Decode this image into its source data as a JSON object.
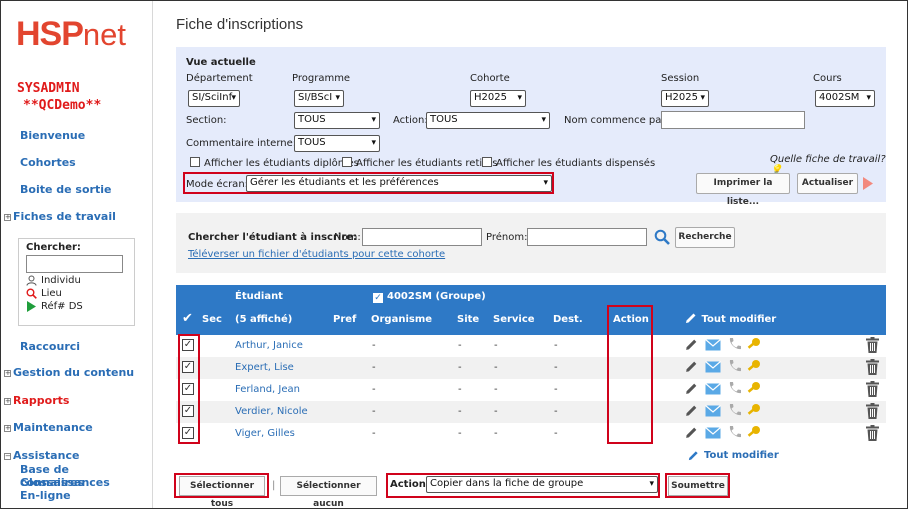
{
  "sidebar": {
    "logo_hsp": "HSP",
    "logo_net": "net",
    "user_name": "SYSADMIN",
    "user_org": "**QCDemo**",
    "items": {
      "bienvenue": "Bienvenue",
      "cohortes": "Cohortes",
      "boite": "Boite de sortie",
      "fiches": "Fiches de travail",
      "raccourci": "Raccourci",
      "gestion": "Gestion du contenu",
      "rapports": "Rapports",
      "maintenance": "Maintenance",
      "assistance": "Assistance",
      "base": "Base de connaissances",
      "glossaires": "Glossaires",
      "enligne": "En-ligne"
    },
    "search": {
      "label": "Chercher:",
      "opt_individu": "Individu",
      "opt_lieu": "Lieu",
      "opt_ref": "Réf# DS"
    }
  },
  "page": {
    "title": "Fiche d'inscriptions"
  },
  "view": {
    "heading": "Vue actuelle",
    "departement_label": "Département",
    "departement_value": "SI/SciInf",
    "programme_label": "Programme",
    "programme_value": "SI/BScI",
    "cohorte_label": "Cohorte",
    "cohorte_value": "H2025",
    "session_label": "Session",
    "session_value": "H2025",
    "cours_label": "Cours",
    "cours_value": "4002SM",
    "section_label": "Section:",
    "section_value": "TOUS",
    "action_label": "Action:",
    "action_value": "TOUS",
    "nom_label": "Nom commence par:",
    "commentaire_label": "Commentaire interne:",
    "commentaire_value": "TOUS",
    "chk_diplomes": "Afficher les étudiants diplômés",
    "chk_retires": "Afficher les étudiants retirés",
    "chk_dispenses": "Afficher les étudiants dispensés",
    "quelle_fiche": "Quelle fiche de travail?",
    "mode_label": "Mode écran:",
    "mode_value": "Gérer les étudiants et les préférences",
    "imprimer": "Imprimer la liste...",
    "actualiser": "Actualiser"
  },
  "search_student": {
    "label": "Chercher l'étudiant à inscrire:",
    "nom_label": "Nom:",
    "prenom_label": "Prénom:",
    "button": "Recherche",
    "upload_link": "Téléverser un fichier d'étudiants pour cette cohorte"
  },
  "table": {
    "h_etudiant": "Étudiant",
    "h_group": "4002SM  (Groupe)",
    "h_sec": "Sec",
    "h_count": "(5 affiché)",
    "h_pref": "Pref",
    "h_organisme": "Organisme",
    "h_site": "Site",
    "h_service": "Service",
    "h_dest": "Dest.",
    "h_action": "Action",
    "h_tout": "Tout modifier",
    "rows": [
      {
        "name": "Arthur, Janice",
        "organisme": "-",
        "site": "-",
        "service": "-",
        "dest": "-"
      },
      {
        "name": "Expert, Lise",
        "organisme": "-",
        "site": "-",
        "service": "-",
        "dest": "-"
      },
      {
        "name": "Ferland, Jean",
        "organisme": "-",
        "site": "-",
        "service": "-",
        "dest": "-"
      },
      {
        "name": "Verdier, Nicole",
        "organisme": "-",
        "site": "-",
        "service": "-",
        "dest": "-"
      },
      {
        "name": "Viger, Gilles",
        "organisme": "-",
        "site": "-",
        "service": "-",
        "dest": "-"
      }
    ],
    "tout_bottom": "Tout modifier"
  },
  "footer": {
    "select_all": "Sélectionner tous",
    "sep": "|",
    "select_none": "Sélectionner aucun",
    "action_label": "Action:",
    "action_value": "Copier dans la fiche de groupe",
    "submit": "Soumettre"
  },
  "colors": {
    "accent": "#2e79c6",
    "brand": "#e2452f",
    "highlight": "#d0021b",
    "panel": "#e5ebfb"
  }
}
